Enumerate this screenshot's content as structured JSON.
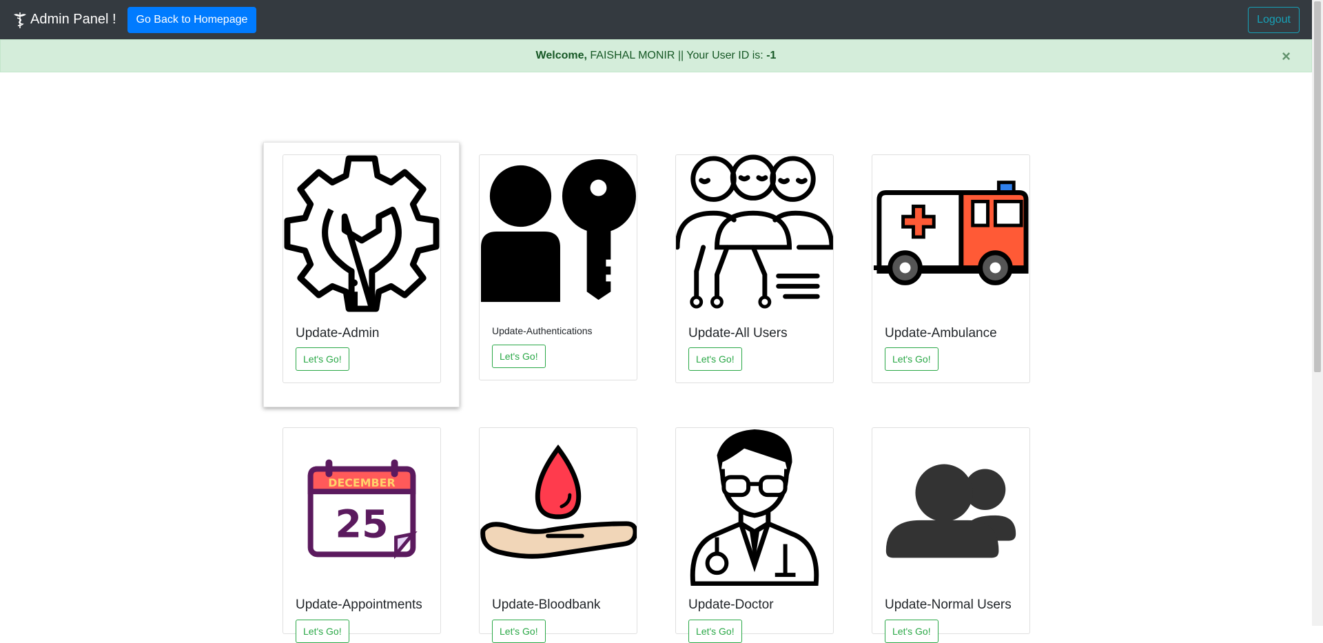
{
  "navbar": {
    "brand": "Admin Panel !",
    "home_button": "Go Back to Homepage",
    "logout_button": "Logout"
  },
  "alert": {
    "welcome": "Welcome,",
    "message": "FAISHAL MONIR || Your User ID is:",
    "user_id": "-1",
    "close": "×"
  },
  "cards": [
    {
      "title": "Update-Admin",
      "button": "Let's Go!",
      "icon": "gear-wrench-icon"
    },
    {
      "title": "Update-Authentications",
      "button": "Let's Go!",
      "icon": "user-key-icon"
    },
    {
      "title": "Update-All Users",
      "button": "Let's Go!",
      "icon": "users-network-icon"
    },
    {
      "title": "Update-Ambulance",
      "button": "Let's Go!",
      "icon": "ambulance-icon"
    },
    {
      "title": "Update-Appointments",
      "button": "Let's Go!",
      "icon": "calendar-icon",
      "calendar_month": "DECEMBER",
      "calendar_day": "25"
    },
    {
      "title": "Update-Bloodbank",
      "button": "Let's Go!",
      "icon": "blood-drop-hand-icon"
    },
    {
      "title": "Update-Doctor",
      "button": "Let's Go!",
      "icon": "doctor-icon"
    },
    {
      "title": "Update-Normal Users",
      "button": "Let's Go!",
      "icon": "users-icon"
    }
  ],
  "colors": {
    "navbar": "#343a40",
    "primary": "#007bff",
    "info": "#17a2b8",
    "success": "#28a745",
    "alert_bg": "#d4edda"
  }
}
